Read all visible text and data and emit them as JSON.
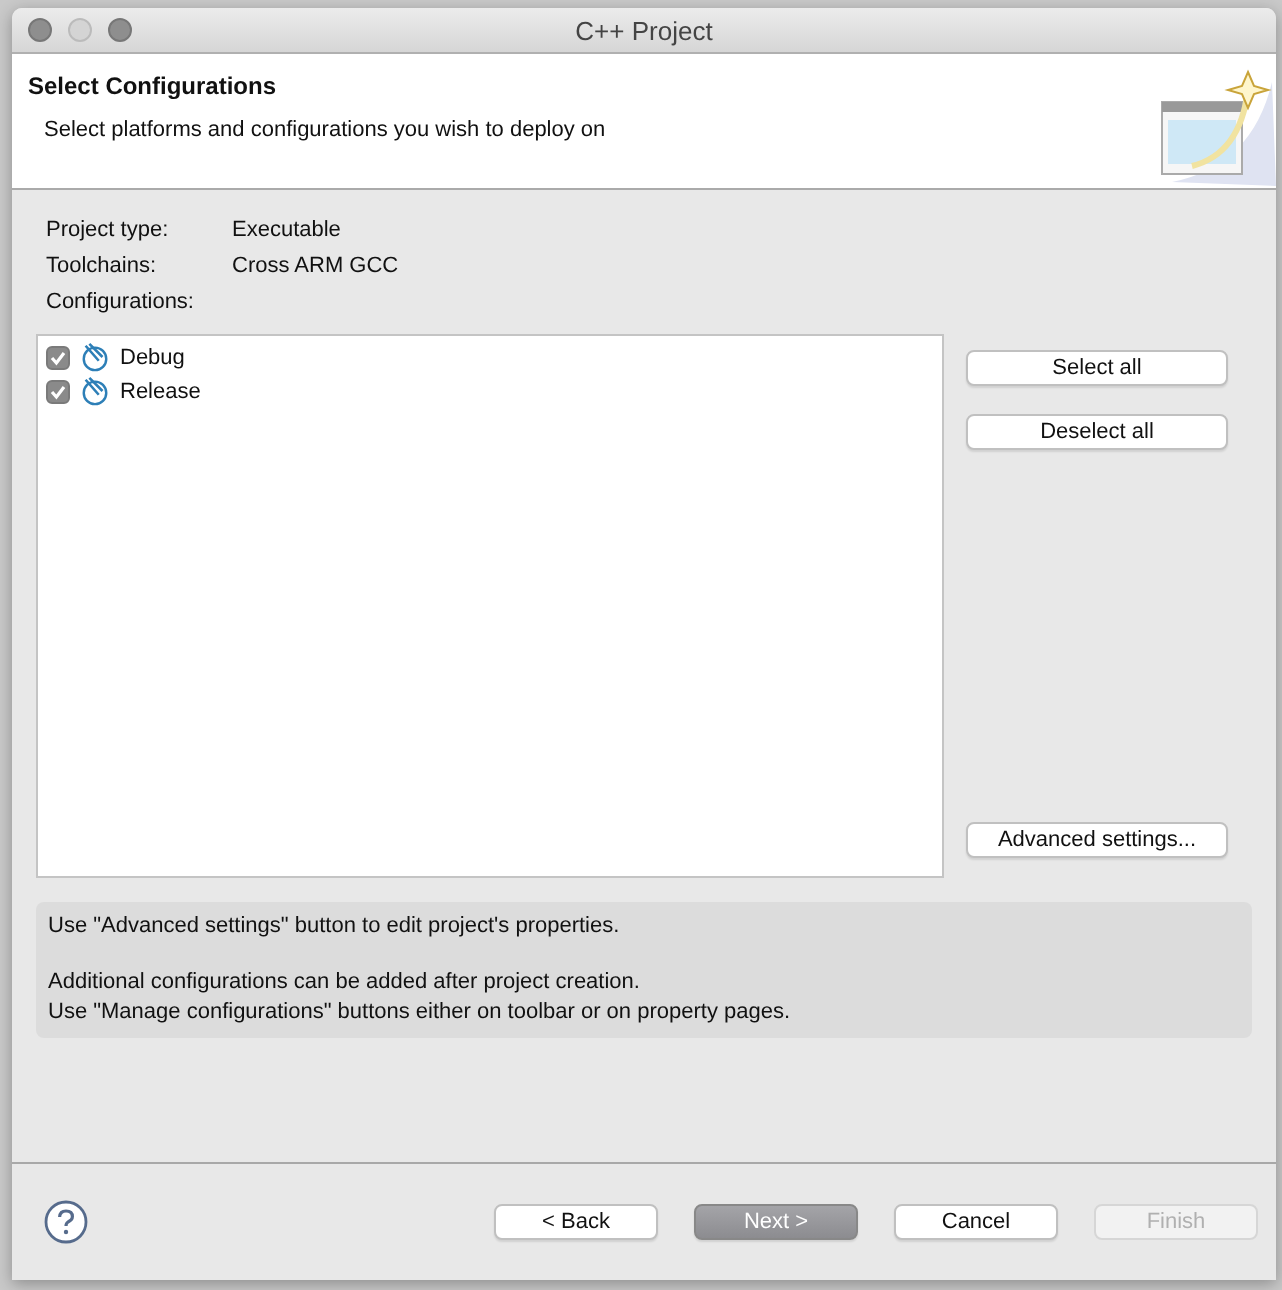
{
  "window": {
    "title": "C++ Project"
  },
  "header": {
    "title": "Select Configurations",
    "description": "Select platforms and configurations you wish to deploy on"
  },
  "properties": [
    {
      "label": "Project type:",
      "value": "Executable"
    },
    {
      "label": "Toolchains:",
      "value": "Cross ARM GCC"
    },
    {
      "label": "Configurations:"
    }
  ],
  "configurations": [
    {
      "name": "Debug",
      "checked": true
    },
    {
      "name": "Release",
      "checked": true
    }
  ],
  "side_buttons": [
    {
      "label": "Select all"
    },
    {
      "label": "Deselect all"
    }
  ],
  "advanced_button": {
    "label": "Advanced settings..."
  },
  "info_paragraphs": [
    [
      "Use \"Advanced settings\" button to edit project's properties."
    ],
    [
      "Additional configurations can be added after project creation.",
      "Use \"Manage configurations\" buttons either on toolbar or on property pages."
    ]
  ],
  "buttons": [
    {
      "label": "< Back",
      "kind": "normal",
      "disabled": false
    },
    {
      "label": "Next >",
      "kind": "default",
      "disabled": false
    },
    {
      "label": "Cancel",
      "kind": "normal",
      "disabled": false
    },
    {
      "label": "Finish",
      "kind": "normal",
      "disabled": true
    }
  ]
}
